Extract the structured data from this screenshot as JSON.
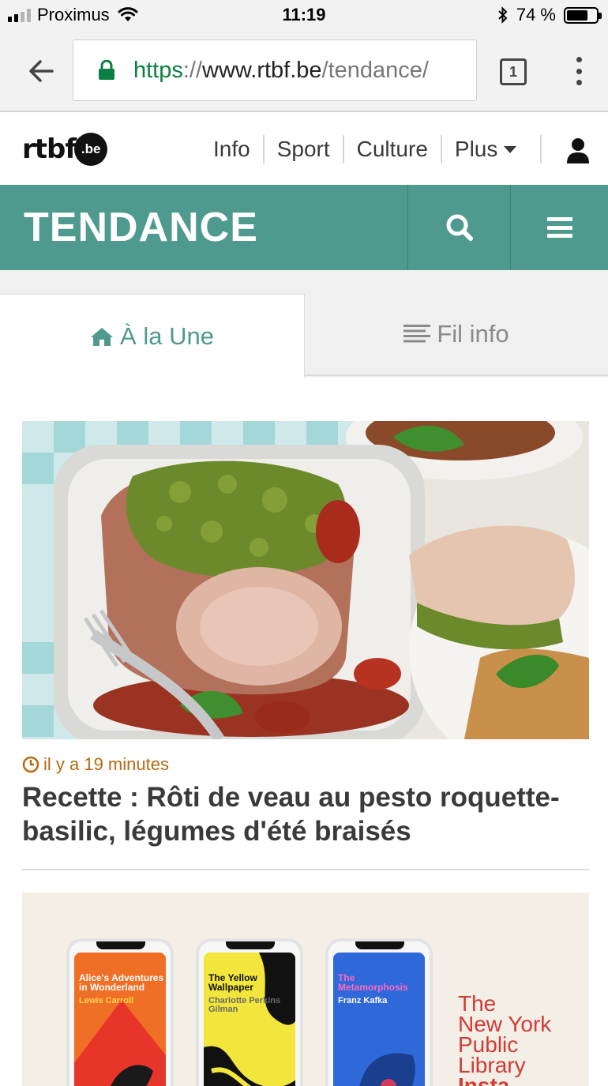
{
  "status_bar": {
    "carrier": "Proximus",
    "time": "11:19",
    "battery": "74 %",
    "battery_level": 0.74
  },
  "browser": {
    "url_scheme": "https",
    "url_sep": "://",
    "url_host": "www.rtbf.be",
    "url_path": "/tendance/",
    "tab_count": "1"
  },
  "site": {
    "logo_wordmark": "rtbf",
    "logo_suffix": ".be",
    "nav": [
      "Info",
      "Sport",
      "Culture",
      "Plus"
    ]
  },
  "section": {
    "title": "TENDANCE"
  },
  "tabs": {
    "active": "À la Une",
    "inactive": "Fil info"
  },
  "articles": [
    {
      "time": "il y a 19 minutes",
      "title": "Recette : Rôti de veau au pesto roquette-basilic, légumes d'été braisés"
    },
    {
      "books": [
        {
          "title": "Alice's Adventures in Wonderland",
          "author": "Lewis Carroll"
        },
        {
          "title": "The Yellow Wallpaper",
          "author": "Charlotte Perkins Gilman"
        },
        {
          "title": "The Metamorphosis",
          "author": "Franz Kafka"
        }
      ],
      "brand_lines": [
        "The",
        "New York",
        "Public",
        "Library",
        "Insta"
      ]
    }
  ],
  "colors": {
    "accent": "#4e9a8e",
    "time_label": "#b9680f",
    "secure": "#0b8043"
  }
}
